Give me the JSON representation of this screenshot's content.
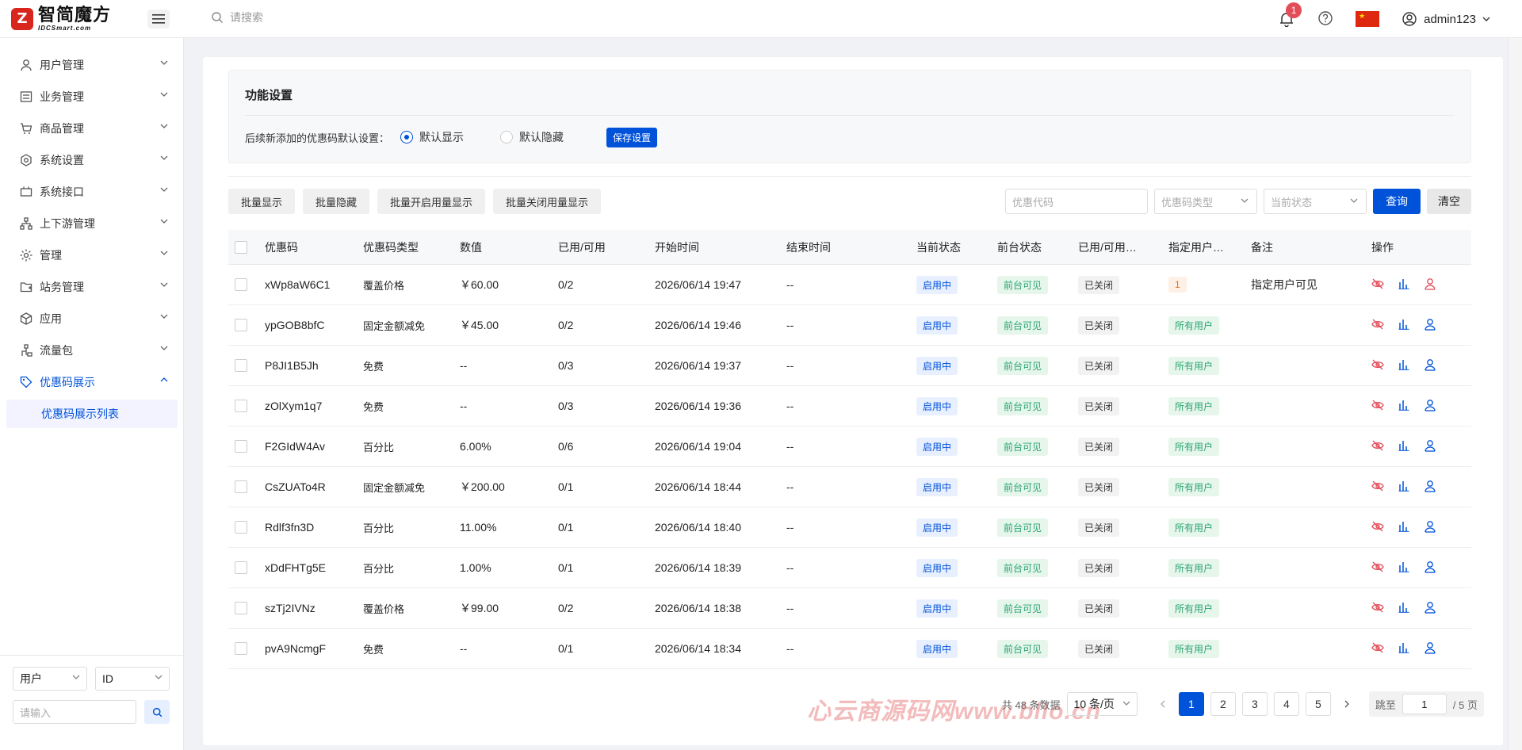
{
  "header": {
    "logo_cn": "智简魔方",
    "logo_en": "IDCSmart.com",
    "search_placeholder": "请搜索",
    "notification_count": "1",
    "username": "admin123"
  },
  "sidebar": {
    "items": [
      {
        "label": "用户管理",
        "icon": "user-icon"
      },
      {
        "label": "业务管理",
        "icon": "list-icon"
      },
      {
        "label": "商品管理",
        "icon": "cart-icon"
      },
      {
        "label": "系统设置",
        "icon": "gear-icon"
      },
      {
        "label": "系统接口",
        "icon": "plug-icon"
      },
      {
        "label": "上下游管理",
        "icon": "network-icon"
      },
      {
        "label": "管理",
        "icon": "sun-icon"
      },
      {
        "label": "站务管理",
        "icon": "folder-icon"
      },
      {
        "label": "应用",
        "icon": "cube-icon"
      },
      {
        "label": "流量包",
        "icon": "flow-icon"
      },
      {
        "label": "优惠码展示",
        "icon": "tag-icon"
      }
    ],
    "sub_item": "优惠码展示列表",
    "bottom": {
      "type_select": "用户",
      "field_select": "ID",
      "input_placeholder": "请输入"
    }
  },
  "function_settings": {
    "title": "功能设置",
    "label": "后续新添加的优惠码默认设置：",
    "option_show": "默认显示",
    "option_hide": "默认隐藏",
    "selected": "默认显示",
    "save_label": "保存设置"
  },
  "toolbar": {
    "batch_show": "批量显示",
    "batch_hide": "批量隐藏",
    "batch_enable_usage": "批量开启用量显示",
    "batch_disable_usage": "批量关闭用量显示"
  },
  "filters": {
    "code_placeholder": "优惠代码",
    "type_placeholder": "优惠码类型",
    "status_placeholder": "当前状态",
    "query_label": "查询",
    "clear_label": "清空"
  },
  "table": {
    "columns": [
      "优惠码",
      "优惠码类型",
      "数值",
      "已用/可用",
      "开始时间",
      "结束时间",
      "当前状态",
      "前台状态",
      "已用/可用…",
      "指定用户…",
      "备注",
      "操作"
    ],
    "rows": [
      {
        "code": "xWp8aW6C1",
        "type": "覆盖价格",
        "value": "￥60.00",
        "usage": "0/2",
        "start": "2026/06/14 19:47",
        "end": "--",
        "status": "启用中",
        "front": "前台可见",
        "usage_display": "已关闭",
        "users": "1",
        "note": "指定用户可见"
      },
      {
        "code": "ypGOB8bfC",
        "type": "固定金额减免",
        "value": "￥45.00",
        "usage": "0/2",
        "start": "2026/06/14 19:46",
        "end": "--",
        "status": "启用中",
        "front": "前台可见",
        "usage_display": "已关闭",
        "users": "所有用户",
        "note": ""
      },
      {
        "code": "P8JI1B5Jh",
        "type": "免费",
        "value": "--",
        "usage": "0/3",
        "start": "2026/06/14 19:37",
        "end": "--",
        "status": "启用中",
        "front": "前台可见",
        "usage_display": "已关闭",
        "users": "所有用户",
        "note": ""
      },
      {
        "code": "zOlXym1q7",
        "type": "免费",
        "value": "--",
        "usage": "0/3",
        "start": "2026/06/14 19:36",
        "end": "--",
        "status": "启用中",
        "front": "前台可见",
        "usage_display": "已关闭",
        "users": "所有用户",
        "note": ""
      },
      {
        "code": "F2GIdW4Av",
        "type": "百分比",
        "value": "6.00%",
        "usage": "0/6",
        "start": "2026/06/14 19:04",
        "end": "--",
        "status": "启用中",
        "front": "前台可见",
        "usage_display": "已关闭",
        "users": "所有用户",
        "note": ""
      },
      {
        "code": "CsZUATo4R",
        "type": "固定金额减免",
        "value": "￥200.00",
        "usage": "0/1",
        "start": "2026/06/14 18:44",
        "end": "--",
        "status": "启用中",
        "front": "前台可见",
        "usage_display": "已关闭",
        "users": "所有用户",
        "note": ""
      },
      {
        "code": "Rdlf3fn3D",
        "type": "百分比",
        "value": "11.00%",
        "usage": "0/1",
        "start": "2026/06/14 18:40",
        "end": "--",
        "status": "启用中",
        "front": "前台可见",
        "usage_display": "已关闭",
        "users": "所有用户",
        "note": ""
      },
      {
        "code": "xDdFHTg5E",
        "type": "百分比",
        "value": "1.00%",
        "usage": "0/1",
        "start": "2026/06/14 18:39",
        "end": "--",
        "status": "启用中",
        "front": "前台可见",
        "usage_display": "已关闭",
        "users": "所有用户",
        "note": ""
      },
      {
        "code": "szTj2IVNz",
        "type": "覆盖价格",
        "value": "￥99.00",
        "usage": "0/2",
        "start": "2026/06/14 18:38",
        "end": "--",
        "status": "启用中",
        "front": "前台可见",
        "usage_display": "已关闭",
        "users": "所有用户",
        "note": ""
      },
      {
        "code": "pvA9NcmgF",
        "type": "免费",
        "value": "--",
        "usage": "0/1",
        "start": "2026/06/14 18:34",
        "end": "--",
        "status": "启用中",
        "front": "前台可见",
        "usage_display": "已关闭",
        "users": "所有用户",
        "note": ""
      }
    ]
  },
  "pagination": {
    "total": "共 48 条数据",
    "page_size": "10 条/页",
    "pages": [
      "1",
      "2",
      "3",
      "4",
      "5"
    ],
    "current": "1",
    "jump_label": "跳至",
    "jump_value": "1",
    "total_pages": "/ 5 页"
  },
  "watermark": "心云商源码网www.bllo.cn",
  "colors": {
    "primary": "#0052d9",
    "success": "#2ba471",
    "danger": "#e34d59",
    "brand": "#d9261c"
  }
}
